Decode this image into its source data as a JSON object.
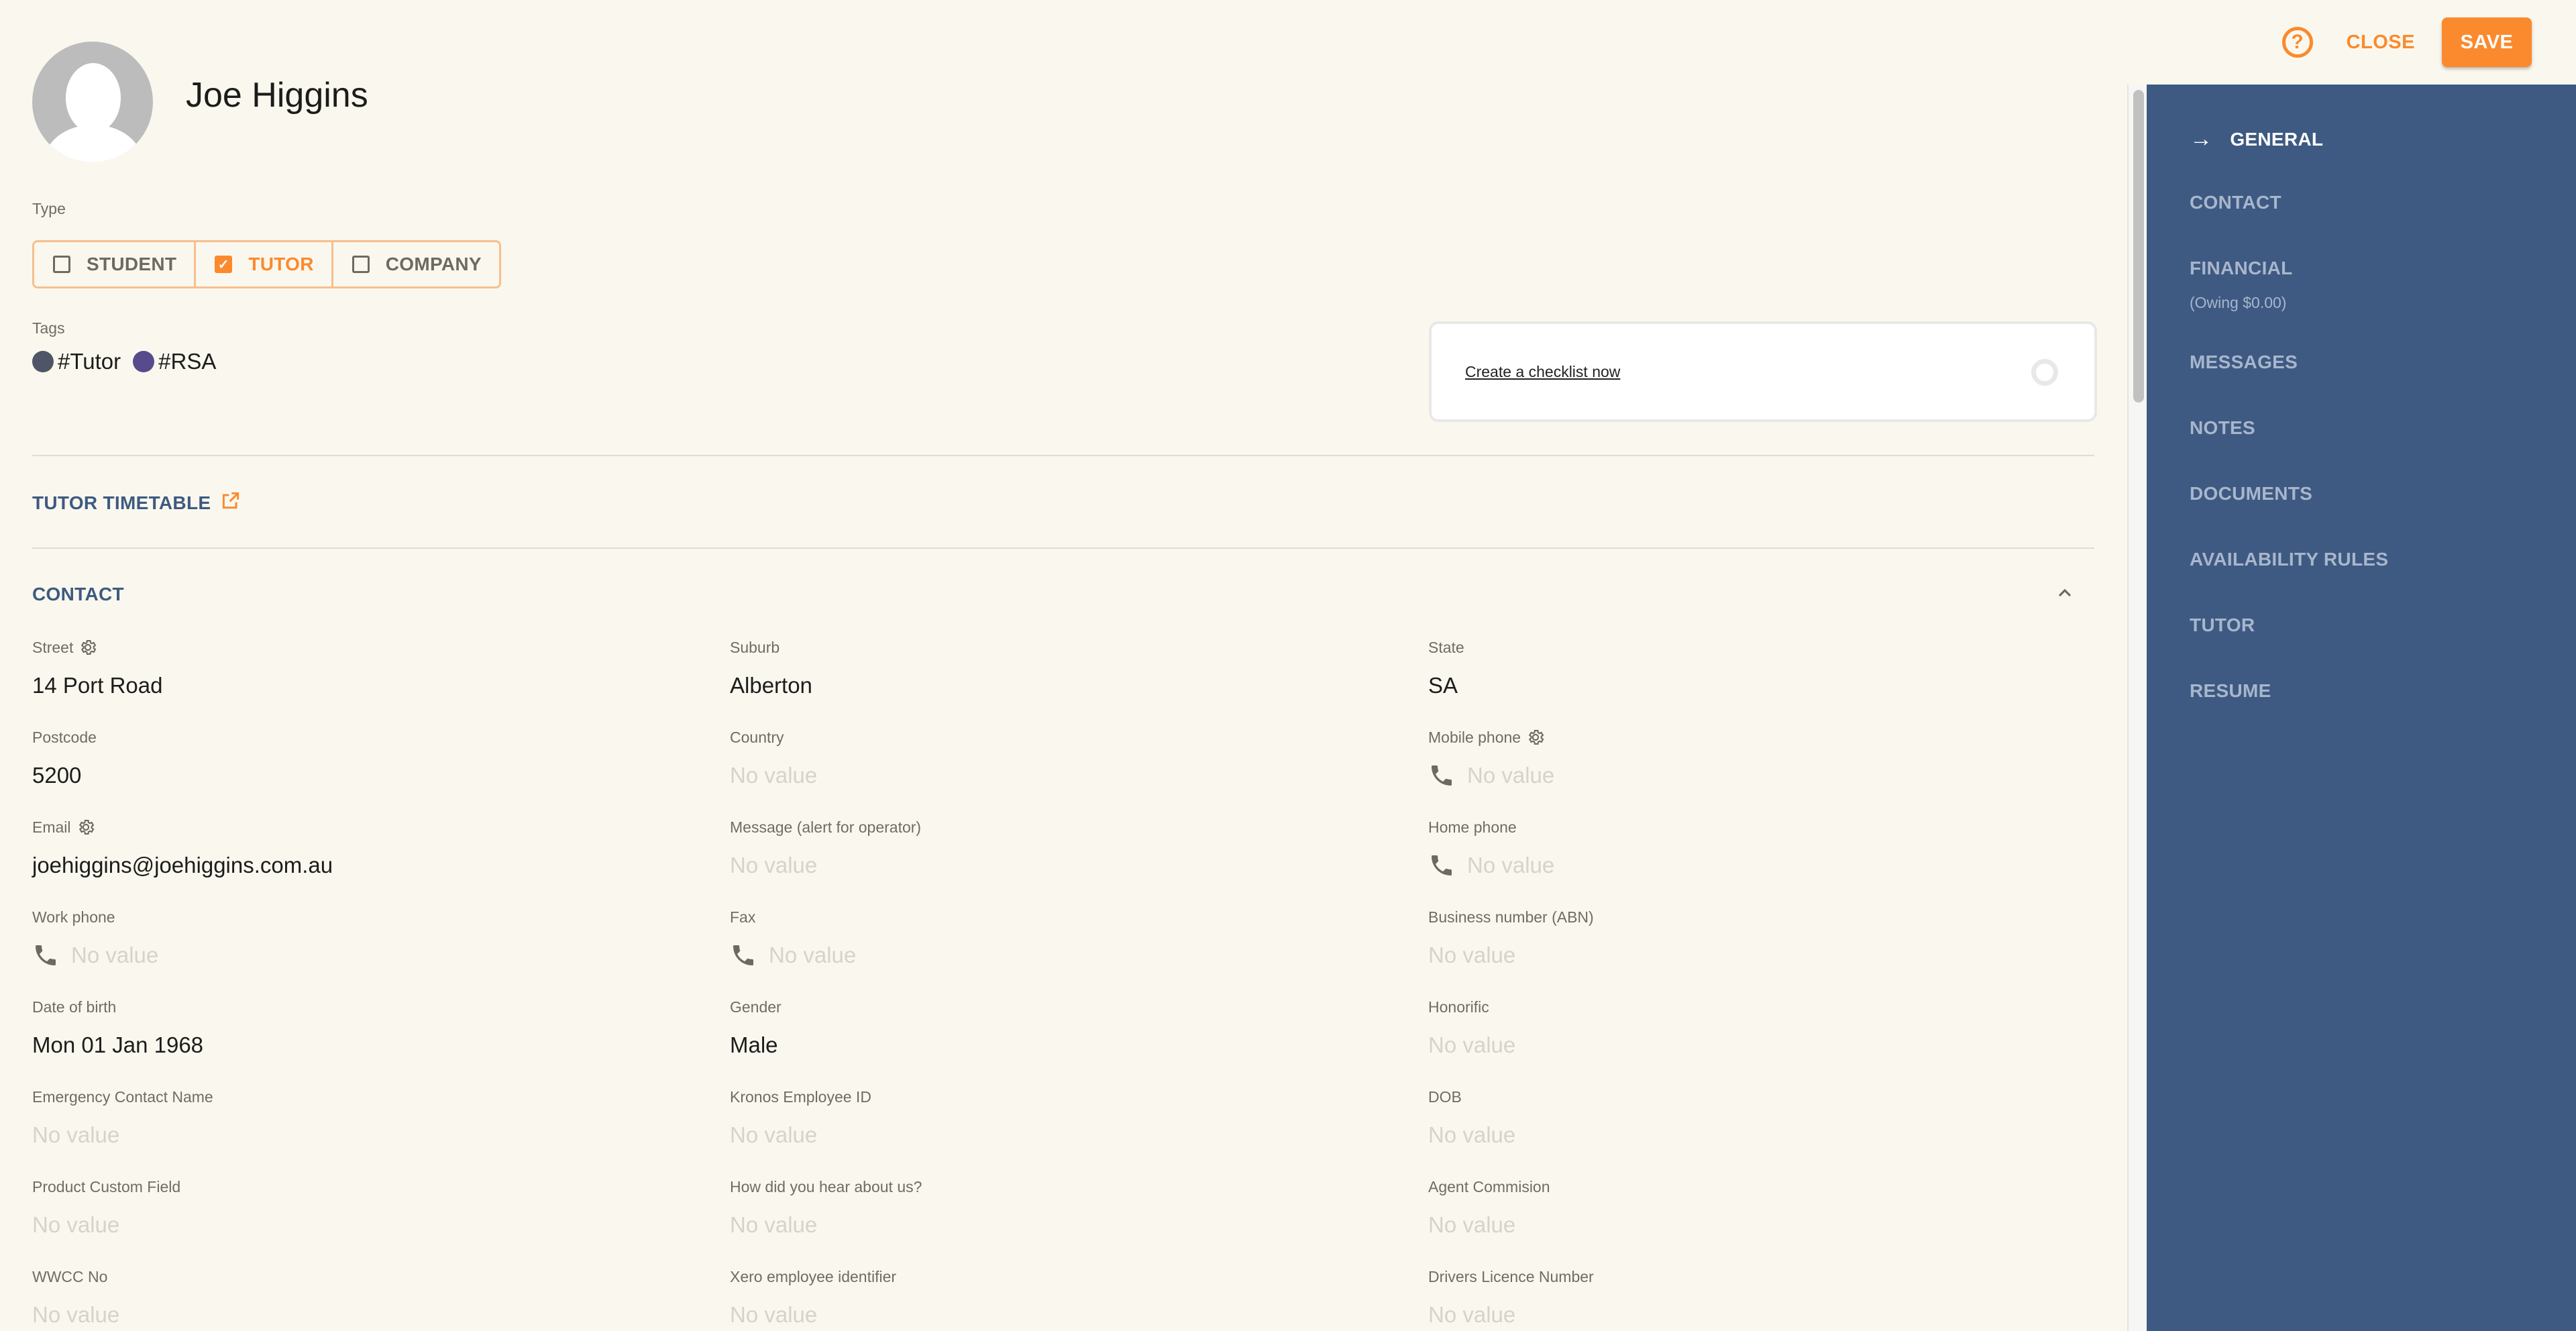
{
  "header": {
    "help_icon": "help-circle-icon",
    "close_label": "CLOSE",
    "save_label": "SAVE",
    "accent_color": "#fb8a2e"
  },
  "profile": {
    "name": "Joe Higgins",
    "type_label": "Type",
    "types": [
      {
        "label": "STUDENT",
        "checked": false
      },
      {
        "label": "TUTOR",
        "checked": true
      },
      {
        "label": "COMPANY",
        "checked": false
      }
    ],
    "tags_label": "Tags",
    "tags": [
      {
        "label": "#Tutor",
        "color": "#4e5566"
      },
      {
        "label": "#RSA",
        "color": "#574b8c"
      }
    ]
  },
  "checklist": {
    "link_label": "Create a checklist now"
  },
  "sections": {
    "timetable_title": "TUTOR TIMETABLE",
    "contact_title": "CONTACT"
  },
  "contact_fields": [
    {
      "label": "Street",
      "value": "14 Port Road",
      "gear": true,
      "phone": false
    },
    {
      "label": "Suburb",
      "value": "Alberton",
      "gear": false,
      "phone": false
    },
    {
      "label": "State",
      "value": "SA",
      "gear": false,
      "phone": false
    },
    {
      "label": "Postcode",
      "value": "5200",
      "gear": false,
      "phone": false
    },
    {
      "label": "Country",
      "value": "No value",
      "empty": true,
      "gear": false,
      "phone": false
    },
    {
      "label": "Mobile phone",
      "value": "No value",
      "empty": true,
      "gear": true,
      "phone": true
    },
    {
      "label": "Email",
      "value": "joehiggins@joehiggins.com.au",
      "gear": true,
      "phone": false
    },
    {
      "label": "Message (alert for operator)",
      "value": "No value",
      "empty": true,
      "gear": false,
      "phone": false
    },
    {
      "label": "Home phone",
      "value": "No value",
      "empty": true,
      "gear": false,
      "phone": true
    },
    {
      "label": "Work phone",
      "value": "No value",
      "empty": true,
      "gear": false,
      "phone": true
    },
    {
      "label": "Fax",
      "value": "No value",
      "empty": true,
      "gear": false,
      "phone": true
    },
    {
      "label": "Business number (ABN)",
      "value": "No value",
      "empty": true,
      "gear": false,
      "phone": false
    },
    {
      "label": "Date of birth",
      "value": "Mon 01 Jan 1968",
      "gear": false,
      "phone": false
    },
    {
      "label": "Gender",
      "value": "Male",
      "gear": false,
      "phone": false
    },
    {
      "label": "Honorific",
      "value": "No value",
      "empty": true,
      "gear": false,
      "phone": false
    },
    {
      "label": "Emergency Contact Name",
      "value": "No value",
      "empty": true,
      "gear": false,
      "phone": false
    },
    {
      "label": "Kronos Employee ID",
      "value": "No value",
      "empty": true,
      "gear": false,
      "phone": false
    },
    {
      "label": "DOB",
      "value": "No value",
      "empty": true,
      "gear": false,
      "phone": false
    },
    {
      "label": "Product Custom Field",
      "value": "No value",
      "empty": true,
      "gear": false,
      "phone": false
    },
    {
      "label": "How did you hear about us?",
      "value": "No value",
      "empty": true,
      "gear": false,
      "phone": false
    },
    {
      "label": "Agent Commision",
      "value": "No value",
      "empty": true,
      "gear": false,
      "phone": false
    },
    {
      "label": "WWCC No",
      "value": "No value",
      "empty": true,
      "gear": false,
      "phone": false
    },
    {
      "label": "Xero employee identifier",
      "value": "No value",
      "empty": true,
      "gear": false,
      "phone": false
    },
    {
      "label": "Drivers Licence Number",
      "value": "No value",
      "empty": true,
      "gear": false,
      "phone": false
    }
  ],
  "sidebar": {
    "bg_color": "#3e5a82",
    "items": [
      {
        "label": "GENERAL",
        "active": true
      },
      {
        "label": "CONTACT"
      },
      {
        "label": "FINANCIAL",
        "sub": "(Owing $0.00)"
      },
      {
        "label": "MESSAGES"
      },
      {
        "label": "NOTES"
      },
      {
        "label": "DOCUMENTS"
      },
      {
        "label": "AVAILABILITY RULES"
      },
      {
        "label": "TUTOR"
      },
      {
        "label": "RESUME"
      }
    ]
  }
}
